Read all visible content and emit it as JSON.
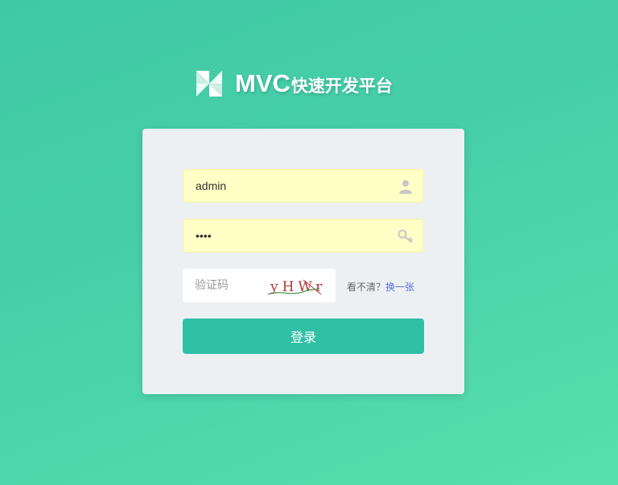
{
  "logo": {
    "icon": "pinwheel-logo-icon",
    "main": "MVC",
    "sub": "快速开发平台"
  },
  "login": {
    "username_value": "admin",
    "username_icon": "user-icon",
    "password_value": "1234",
    "password_icon": "key-icon",
    "captcha_placeholder": "验证码",
    "captcha_text": "yHWr",
    "refresh_prefix": "看不清？",
    "refresh_link": "换一张",
    "submit": "登录"
  },
  "colors": {
    "accent": "#2fc0a5",
    "field_bg": "#ffffc6",
    "link": "#5a6ee0"
  }
}
